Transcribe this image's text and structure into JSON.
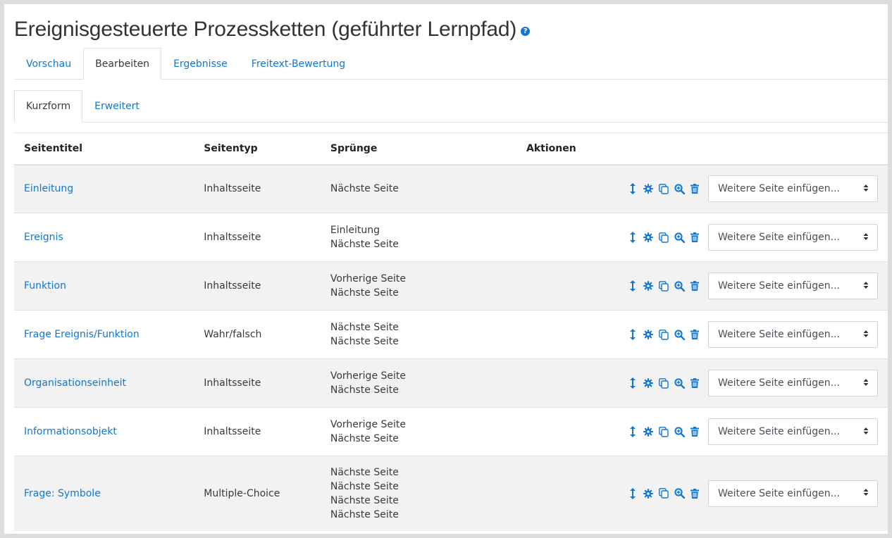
{
  "page": {
    "title": "Ereignisgesteuerte Prozessketten (geführter Lernpfad)",
    "help_icon": "question-circle-icon"
  },
  "primary_tabs": [
    {
      "label": "Vorschau",
      "active": false
    },
    {
      "label": "Bearbeiten",
      "active": true
    },
    {
      "label": "Ergebnisse",
      "active": false
    },
    {
      "label": "Freitext-Bewertung",
      "active": false
    }
  ],
  "secondary_tabs": [
    {
      "label": "Kurzform",
      "active": true
    },
    {
      "label": "Erweitert",
      "active": false
    }
  ],
  "table": {
    "headers": {
      "title": "Seitentitel",
      "type": "Seitentyp",
      "jumps": "Sprünge",
      "actions": "Aktionen"
    },
    "select_placeholder": "Weitere Seite einfügen...",
    "action_icons": [
      "move-icon",
      "settings-icon",
      "duplicate-icon",
      "preview-icon",
      "delete-icon"
    ],
    "rows": [
      {
        "title": "Einleitung",
        "type": "Inhaltsseite",
        "jumps": [
          "Nächste Seite"
        ]
      },
      {
        "title": "Ereignis",
        "type": "Inhaltsseite",
        "jumps": [
          "Einleitung",
          "Nächste Seite"
        ]
      },
      {
        "title": "Funktion",
        "type": "Inhaltsseite",
        "jumps": [
          "Vorherige Seite",
          "Nächste Seite"
        ]
      },
      {
        "title": "Frage Ereignis/Funktion",
        "type": "Wahr/falsch",
        "jumps": [
          "Nächste Seite",
          "Nächste Seite"
        ]
      },
      {
        "title": "Organisationseinheit",
        "type": "Inhaltsseite",
        "jumps": [
          "Vorherige Seite",
          "Nächste Seite"
        ]
      },
      {
        "title": "Informationsobjekt",
        "type": "Inhaltsseite",
        "jumps": [
          "Vorherige Seite",
          "Nächste Seite"
        ]
      },
      {
        "title": "Frage: Symbole",
        "type": "Multiple-Choice",
        "jumps": [
          "Nächste Seite",
          "Nächste Seite",
          "Nächste Seite",
          "Nächste Seite"
        ]
      }
    ]
  },
  "colors": {
    "link": "#1177d1",
    "stripe": "#f2f2f2",
    "border": "#dee2e6"
  }
}
